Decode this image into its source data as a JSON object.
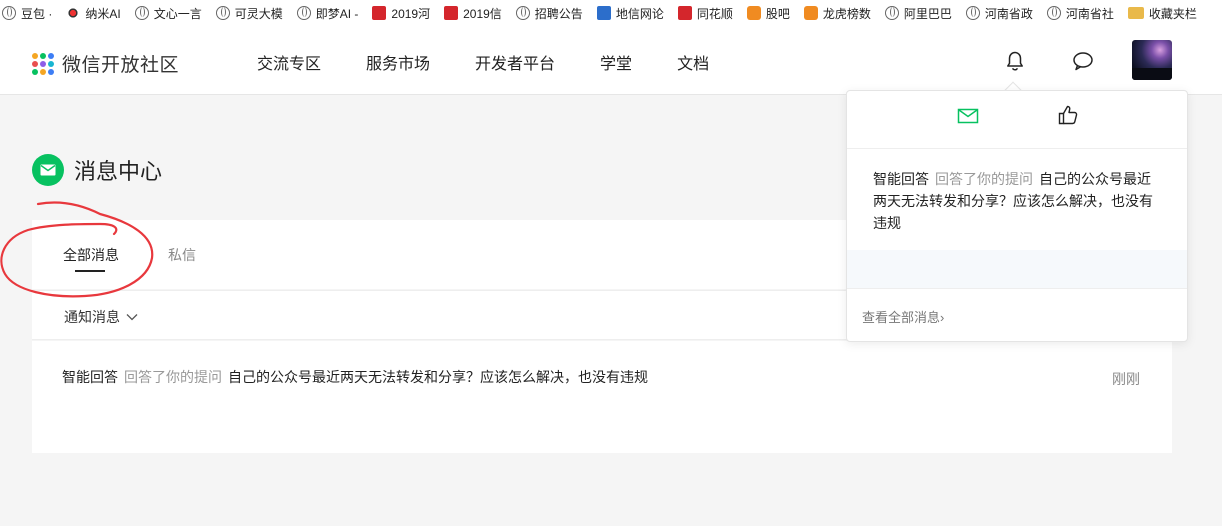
{
  "bookmarks": [
    {
      "label": "豆包 ·",
      "icon": "globe-icon"
    },
    {
      "label": "纳米AI",
      "icon": "nami-icon"
    },
    {
      "label": "文心一言",
      "icon": "globe-icon"
    },
    {
      "label": "可灵大模",
      "icon": "globe-icon"
    },
    {
      "label": "即梦AI -",
      "icon": "globe-icon"
    },
    {
      "label": "2019河",
      "icon": "red-badge-icon"
    },
    {
      "label": "2019信",
      "icon": "red-badge-icon"
    },
    {
      "label": "招聘公告",
      "icon": "globe-icon"
    },
    {
      "label": "地信网论",
      "icon": "blue-badge-icon"
    },
    {
      "label": "同花顺",
      "icon": "red-badge-icon"
    },
    {
      "label": "股吧",
      "icon": "orange-badge-icon"
    },
    {
      "label": "龙虎榜数",
      "icon": "orange-badge-icon"
    },
    {
      "label": "阿里巴巴",
      "icon": "globe-icon"
    },
    {
      "label": "河南省政",
      "icon": "globe-icon"
    },
    {
      "label": "河南省社",
      "icon": "globe-icon"
    },
    {
      "label": "收藏夹栏",
      "icon": "folder-icon"
    }
  ],
  "header": {
    "logo_text": "微信开放社区",
    "nav": [
      "交流专区",
      "服务市场",
      "开发者平台",
      "学堂",
      "文档"
    ]
  },
  "page": {
    "title": "消息中心",
    "tabs": [
      "全部消息",
      "私信"
    ],
    "filter_label": "通知消息",
    "messages": [
      {
        "from": "智能回答",
        "action": "回答了你的提问",
        "subject": "自己的公众号最近两天无法转发和分享？应该怎么解决，也没有违规",
        "time": "刚刚"
      }
    ]
  },
  "popup": {
    "message": {
      "from": "智能回答",
      "action": "回答了你的提问",
      "subject": "自己的公众号最近两天无法转发和分享？应该怎么解决，也没有违规"
    },
    "view_all": "查看全部消息",
    "view_all_arrow": "›"
  },
  "colors": {
    "accent": "#07c160",
    "annotation": "#e8383d"
  }
}
